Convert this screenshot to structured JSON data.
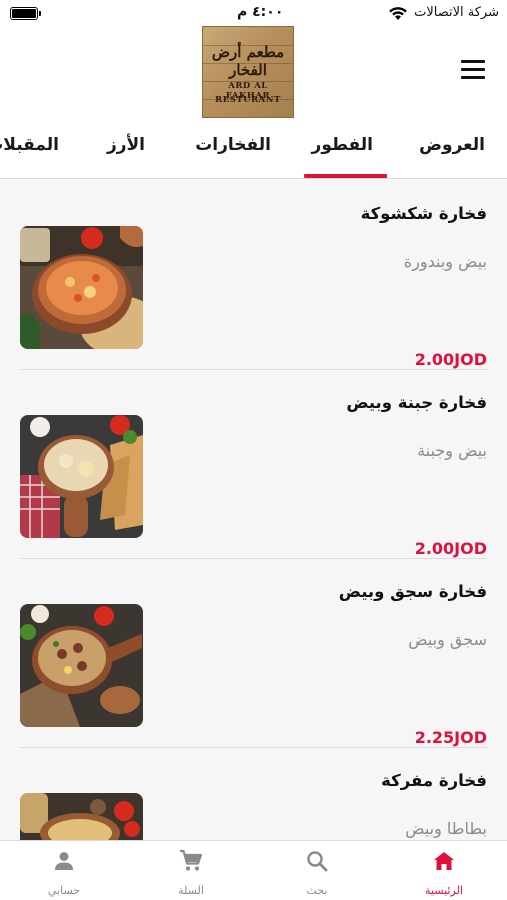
{
  "status_bar": {
    "carrier": "شركة الاتصالات",
    "time": "٤:٠٠ م",
    "battery_level": 1.0
  },
  "header": {
    "logo_arabic": "مطعم أرض الفخار",
    "logo_latin_1": "ARD AL FAKHAR",
    "logo_latin_2": "RESTURANT",
    "menu_icon": "hamburger-menu-icon"
  },
  "categories": {
    "tabs": [
      {
        "label": "العروض"
      },
      {
        "label": "الفطور"
      },
      {
        "label": "الفخارات"
      },
      {
        "label": "الأرز"
      },
      {
        "label": "المقبلات"
      }
    ],
    "active_index": 1
  },
  "items": [
    {
      "title": "فخارة شكشوكة",
      "description": "بيض وبندورة",
      "price": "2.00JOD"
    },
    {
      "title": "فخارة جبنة وبيض",
      "description": "بيض وجبنة",
      "price": "2.00JOD"
    },
    {
      "title": "فخارة سجق وبيض",
      "description": "سجق وبيض",
      "price": "2.25JOD"
    },
    {
      "title": "فخارة مفركة",
      "description": "بطاطا وبيض",
      "price": ""
    }
  ],
  "bottom_nav": {
    "items": [
      {
        "label": "الرئيسية",
        "icon": "home-icon",
        "active": true
      },
      {
        "label": "بحث",
        "icon": "search-icon",
        "active": false
      },
      {
        "label": "السلة",
        "icon": "cart-icon",
        "active": false
      },
      {
        "label": "حسابي",
        "icon": "person-icon",
        "active": false
      }
    ]
  },
  "colors": {
    "accent": "#e0103d",
    "inactive": "#8a8a8a"
  }
}
